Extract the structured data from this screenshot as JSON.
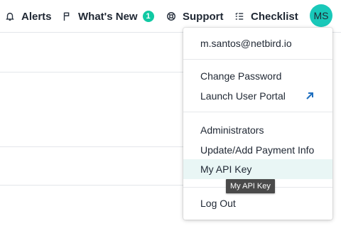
{
  "nav": {
    "alerts": "Alerts",
    "whats_new": "What's New",
    "whats_new_badge": "1",
    "support": "Support",
    "checklist": "Checklist",
    "avatar_initials": "MS"
  },
  "icons": {
    "alerts": "bell-icon",
    "whats_new": "flag-icon",
    "support": "lifebuoy-icon",
    "checklist": "checklist-icon",
    "launch_portal": "external-arrow-icon"
  },
  "colors": {
    "accent": "#19c8b9",
    "badge": "#10c9a3",
    "hover_row": "#e9f6f5",
    "link_arrow": "#1f6fbf",
    "tooltip_bg": "#4a4a4a"
  },
  "menu": {
    "email": "m.santos@netbird.io",
    "change_password": "Change Password",
    "launch_user_portal": "Launch User Portal",
    "administrators": "Administrators",
    "update_payment": "Update/Add Payment Info",
    "my_api_key": "My API Key",
    "log_out": "Log Out"
  },
  "tooltip": {
    "text": "My API Key"
  }
}
